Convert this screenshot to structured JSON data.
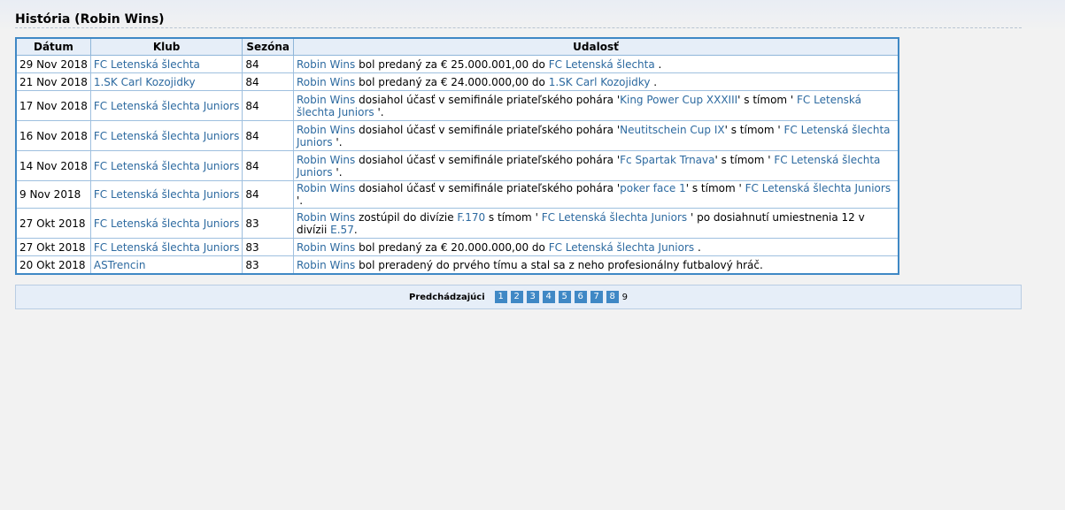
{
  "page": {
    "title": "História (Robin Wins)"
  },
  "table": {
    "headers": [
      "Dátum",
      "Klub",
      "Sezóna",
      "Udalosť"
    ],
    "rows": [
      {
        "date": "29 Nov 2018",
        "club": "FC Letenská šlechta",
        "season": "84",
        "event": {
          "player": "Robin Wins",
          "t1": " bol predaný za  € 25.000.001,00 do ",
          "link2": "FC Letenská šlechta",
          "t2": " ."
        }
      },
      {
        "date": "21 Nov 2018",
        "club": "1.SK Carl Kozojidky",
        "season": "84",
        "event": {
          "player": "Robin Wins",
          "t1": " bol predaný za  € 24.000.000,00 do ",
          "link2": "1.SK Carl Kozojidky",
          "t2": " ."
        }
      },
      {
        "date": "17 Nov 2018",
        "club": "FC Letenská šlechta Juniors",
        "season": "84",
        "event": {
          "player": "Robin Wins",
          "t1": " dosiahol účasť v semifinále priateľského pohára '",
          "link2": "King Power Cup XXXIII",
          "t2": "' s tímom ' ",
          "link3": "FC Letenská šlechta Juniors",
          "t3": " '."
        }
      },
      {
        "date": "16 Nov 2018",
        "club": "FC Letenská šlechta Juniors",
        "season": "84",
        "event": {
          "player": "Robin Wins",
          "t1": " dosiahol účasť v semifinále priateľského pohára '",
          "link2": "Neutitschein Cup IX",
          "t2": "' s tímom ' ",
          "link3": "FC Letenská šlechta Juniors",
          "t3": " '."
        }
      },
      {
        "date": "14 Nov 2018",
        "club": "FC Letenská šlechta Juniors",
        "season": "84",
        "event": {
          "player": "Robin Wins",
          "t1": " dosiahol účasť v semifinále priateľského pohára '",
          "link2": "Fc Spartak Trnava",
          "t2": "' s tímom ' ",
          "link3": "FC Letenská šlechta Juniors",
          "t3": " '."
        }
      },
      {
        "date": "9 Nov 2018",
        "club": "FC Letenská šlechta Juniors",
        "season": "84",
        "event": {
          "player": "Robin Wins",
          "t1": " dosiahol účasť v semifinále priateľského pohára '",
          "link2": "poker face 1",
          "t2": "' s tímom ' ",
          "link3": "FC Letenská šlechta Juniors",
          "t3": " '."
        }
      },
      {
        "date": "27 Okt 2018",
        "club": "FC Letenská šlechta Juniors",
        "season": "83",
        "event": {
          "player": "Robin Wins",
          "t1": " zostúpil do divízie ",
          "link2": "F.170",
          "t2": " s tímom ' ",
          "link3": "FC Letenská šlechta Juniors",
          "t3": " ' po dosiahnutí umiestnenia 12 v divízii ",
          "link4": "E.57",
          "t4": "."
        }
      },
      {
        "date": "27 Okt 2018",
        "club": "FC Letenská šlechta Juniors",
        "season": "83",
        "event": {
          "player": "Robin Wins",
          "t1": " bol predaný za  € 20.000.000,00 do ",
          "link2": "FC Letenská šlechta Juniors",
          "t2": " ."
        }
      },
      {
        "date": "20 Okt 2018",
        "club": "ASTrencin",
        "season": "83",
        "event": {
          "player": "Robin Wins",
          "t1": " bol preradený do prvého tímu a stal sa z neho profesionálny futbalový hráč."
        }
      }
    ]
  },
  "pager": {
    "prev_label": "Predchádzajúci",
    "pages": [
      "1",
      "2",
      "3",
      "4",
      "5",
      "6",
      "7",
      "8"
    ],
    "current": "9"
  }
}
